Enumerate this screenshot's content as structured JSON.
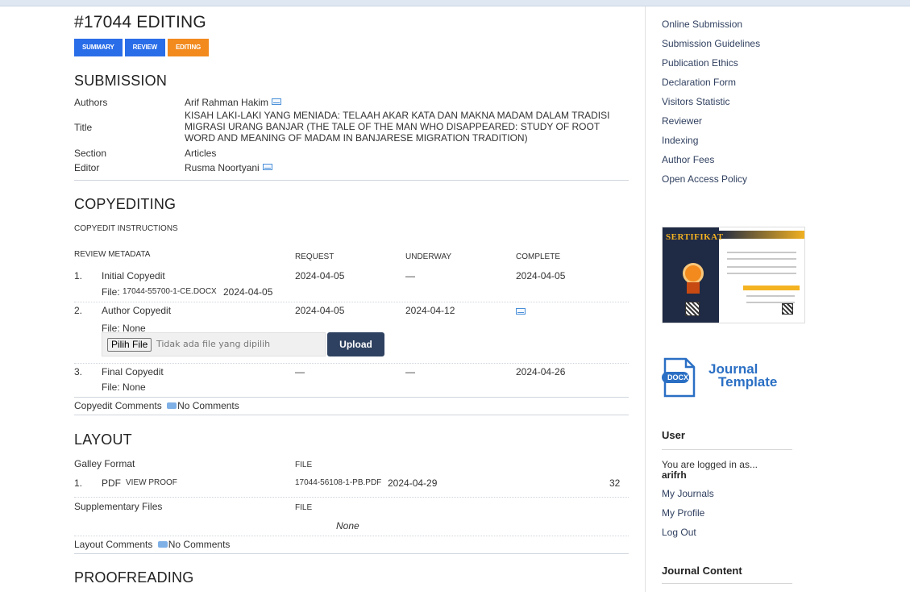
{
  "page": {
    "title": "#17044 EDITING",
    "tabs": [
      {
        "label": "SUMMARY",
        "color": "#2a6de8"
      },
      {
        "label": "REVIEW",
        "color": "#2a6de8"
      },
      {
        "label": "EDITING",
        "color": "#f28a1e"
      }
    ]
  },
  "submission": {
    "heading": "SUBMISSION",
    "authors_label": "Authors",
    "authors_value": "Arif Rahman Hakim",
    "title_label": "Title",
    "title_value": "KISAH LAKI-LAKI YANG MENIADA: TELAAH AKAR KATA DAN MAKNA MADAM DALAM TRADISI MIGRASI URANG BANJAR (THE TALE OF THE MAN WHO DISAPPEARED: STUDY OF ROOT WORD AND MEANING OF MADAM IN BANJARESE MIGRATION TRADITION)",
    "section_label": "Section",
    "section_value": "Articles",
    "editor_label": "Editor",
    "editor_value": "Rusma Noortyani"
  },
  "copyediting": {
    "heading": "COPYEDITING",
    "instructions_link": "COPYEDIT INSTRUCTIONS",
    "review_metadata_link": "REVIEW METADATA",
    "col_request": "REQUEST",
    "col_underway": "UNDERWAY",
    "col_complete": "COMPLETE",
    "rows": [
      {
        "num": "1.",
        "name": "Initial Copyedit",
        "request": "2024-04-05",
        "underway": "—",
        "complete": "2024-04-05",
        "file_label": "File:",
        "file_link": "17044-55700-1-CE.DOCX",
        "file_date": "2024-04-05"
      },
      {
        "num": "2.",
        "name": "Author Copyedit",
        "request": "2024-04-05",
        "underway": "2024-04-12",
        "complete": "",
        "file_label": "File: None"
      },
      {
        "num": "3.",
        "name": "Final Copyedit",
        "request": "—",
        "underway": "—",
        "complete": "2024-04-26",
        "file_label": "File: None"
      }
    ],
    "choose_file_label": "Pilih File",
    "no_file_text": "Tidak ada file yang dipilih",
    "upload_label": "Upload",
    "comments_label": "Copyedit Comments",
    "comments_value": "No Comments"
  },
  "layout": {
    "heading": "LAYOUT",
    "galley_format_label": "Galley Format",
    "file_col": "FILE",
    "galley_num": "1.",
    "galley_type": "PDF",
    "view_proof": "VIEW PROOF",
    "galley_file": "17044-56108-1-PB.PDF",
    "galley_date": "2024-04-29",
    "galley_count": "32",
    "supp_label": "Supplementary Files",
    "supp_file_col": "FILE",
    "supp_none": "None",
    "comments_label": "Layout Comments",
    "comments_value": "No Comments"
  },
  "proofreading": {
    "heading": "PROOFREADING"
  },
  "sidebar": {
    "links": [
      "Online Submission",
      "Submission Guidelines",
      "Publication Ethics",
      "Declaration Form",
      "Visitors Statistic",
      "Reviewer",
      "Indexing",
      "Author Fees",
      "Open Access Policy"
    ],
    "certificate_title": "SERTIFIKAT",
    "docx_badge": "DOCX",
    "docx_line1": "Journal",
    "docx_line2": "Template",
    "user_heading": "User",
    "logged_in_text": "You are logged in as...",
    "username": "arifrh",
    "user_links": [
      "My Journals",
      "My Profile",
      "Log Out"
    ],
    "journal_content_heading": "Journal Content"
  }
}
